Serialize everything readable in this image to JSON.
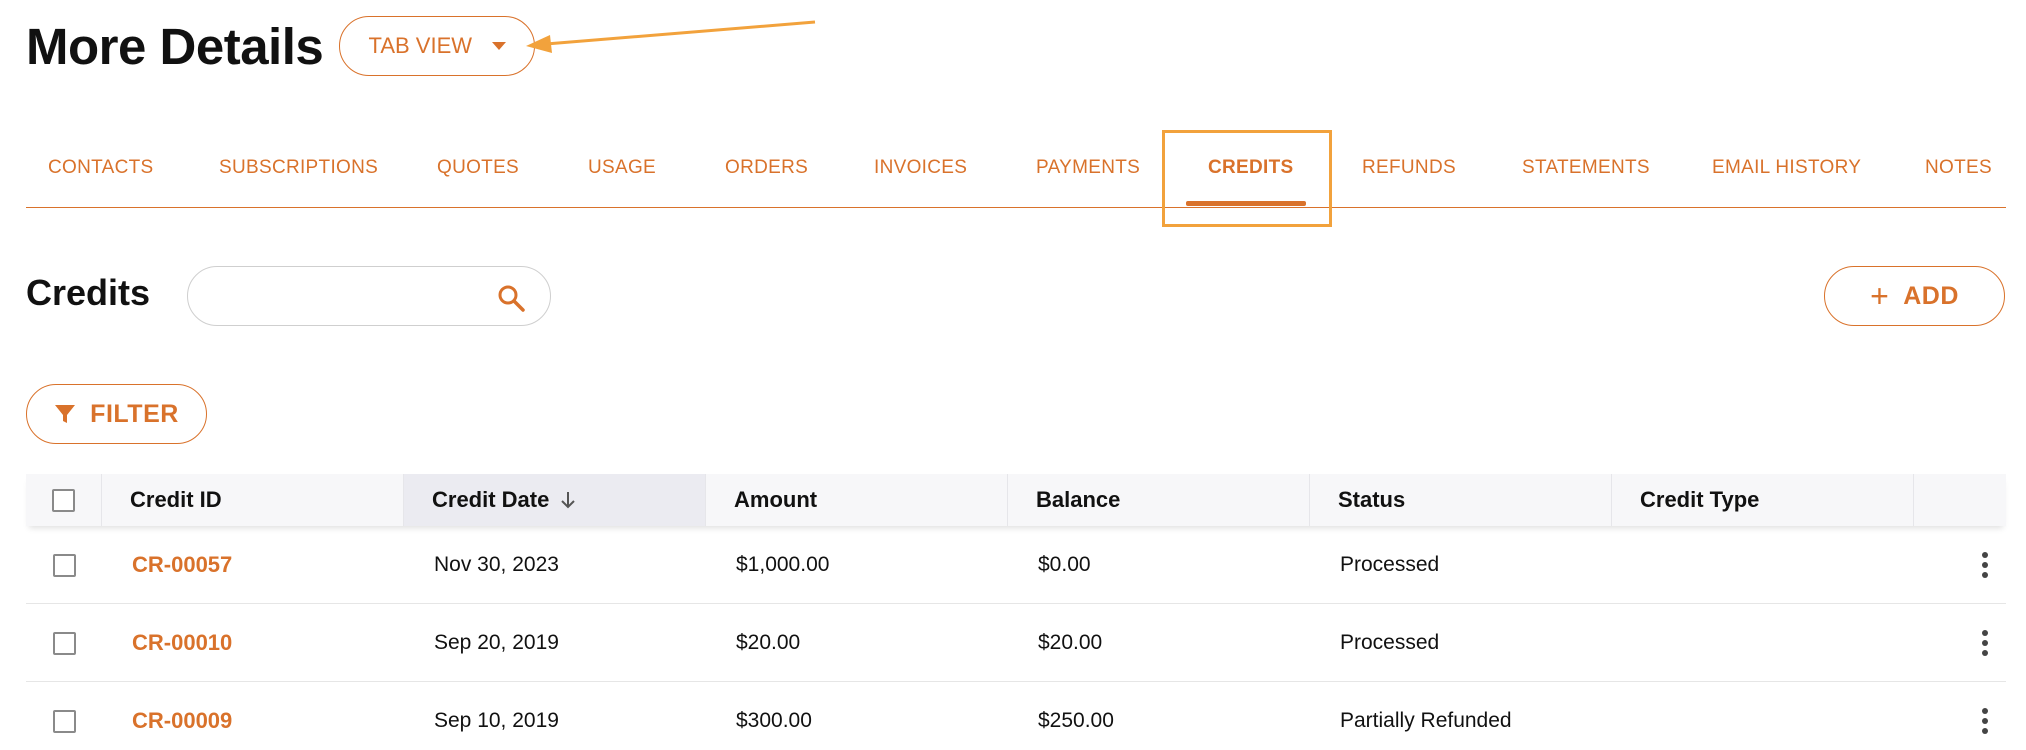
{
  "header": {
    "title": "More Details",
    "view_select": "TAB VIEW"
  },
  "tabs": [
    {
      "label": "CONTACTS"
    },
    {
      "label": "SUBSCRIPTIONS"
    },
    {
      "label": "QUOTES"
    },
    {
      "label": "USAGE"
    },
    {
      "label": "ORDERS"
    },
    {
      "label": "INVOICES"
    },
    {
      "label": "PAYMENTS"
    },
    {
      "label": "CREDITS",
      "active": true
    },
    {
      "label": "REFUNDS"
    },
    {
      "label": "STATEMENTS"
    },
    {
      "label": "EMAIL HISTORY"
    },
    {
      "label": "NOTES"
    }
  ],
  "section": {
    "title": "Credits",
    "search_placeholder": "",
    "add_label": "ADD",
    "filter_label": "FILTER"
  },
  "table": {
    "columns": [
      "Credit ID",
      "Credit Date",
      "Amount",
      "Balance",
      "Status",
      "Credit Type"
    ],
    "sorted_column": "Credit Date",
    "rows": [
      {
        "id": "CR-00057",
        "date": "Nov 30, 2023",
        "amount": "$1,000.00",
        "balance": "$0.00",
        "status": "Processed",
        "type": ""
      },
      {
        "id": "CR-00010",
        "date": "Sep 20, 2019",
        "amount": "$20.00",
        "balance": "$20.00",
        "status": "Processed",
        "type": ""
      },
      {
        "id": "CR-00009",
        "date": "Sep 10, 2019",
        "amount": "$300.00",
        "balance": "$250.00",
        "status": "Partially Refunded",
        "type": ""
      }
    ]
  },
  "colors": {
    "accent": "#d9722b",
    "highlight": "#f2a23c"
  },
  "icons": {
    "view_select": "caret-down-icon",
    "search": "search-icon",
    "add": "plus-icon",
    "filter": "filter-funnel-icon",
    "sort": "arrow-down-icon",
    "row_menu": "more-vertical-icon",
    "annotation": "annotation-arrow-icon"
  }
}
